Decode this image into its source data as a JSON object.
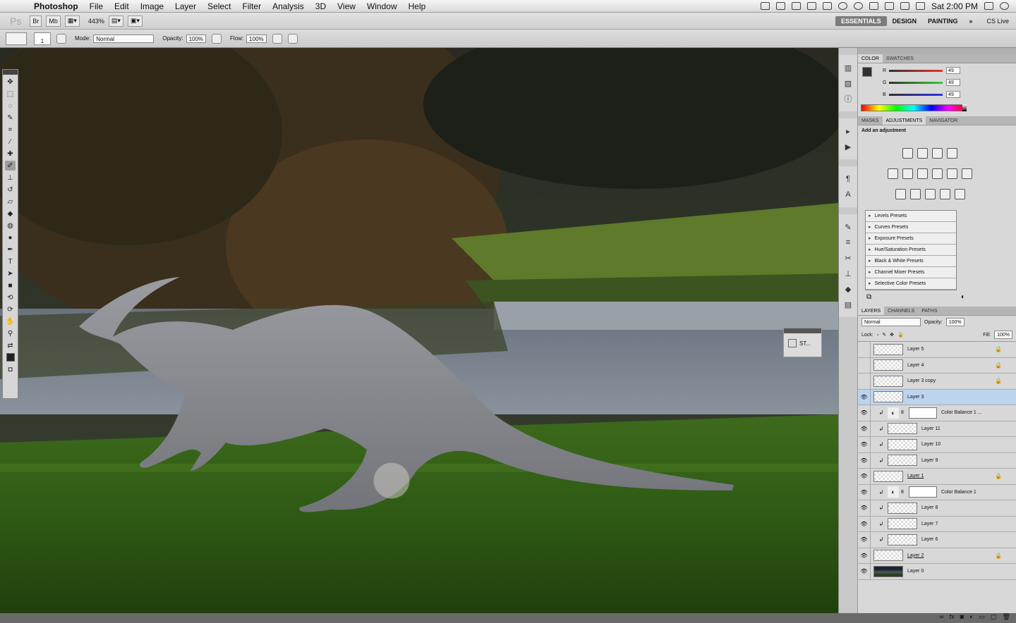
{
  "menubar": {
    "app": "Photoshop",
    "items": [
      "File",
      "Edit",
      "Image",
      "Layer",
      "Select",
      "Filter",
      "Analysis",
      "3D",
      "View",
      "Window",
      "Help"
    ],
    "clock": "Sat 2:00 PM"
  },
  "appbar": {
    "logo": "Ps",
    "zoom": "443%",
    "workspaces": [
      "ESSENTIALS",
      "DESIGN",
      "PAINTING"
    ],
    "more": "»",
    "cslive": "CS Live"
  },
  "options": {
    "brush_size": "1",
    "mode_label": "Mode:",
    "mode_value": "Normal",
    "opacity_label": "Opacity:",
    "opacity_value": "100%",
    "flow_label": "Flow:",
    "flow_value": "100%"
  },
  "mini_panel": {
    "label": "ST..."
  },
  "color_panel": {
    "tabs": [
      "COLOR",
      "SWATCHES"
    ],
    "r_label": "R",
    "g_label": "G",
    "b_label": "B",
    "r": "49",
    "g": "49",
    "b": "49",
    "foreground": "#313131"
  },
  "adjust_panel": {
    "tabs": [
      "MASKS",
      "ADJUSTMENTS",
      "NAVIGATOR"
    ],
    "title": "Add an adjustment",
    "presets": [
      "Levels Presets",
      "Curves Presets",
      "Exposure Presets",
      "Hue/Saturation Presets",
      "Black & White Presets",
      "Channel Mixer Presets",
      "Selective Color Presets"
    ]
  },
  "layers_panel": {
    "tabs": [
      "LAYERS",
      "CHANNELS",
      "PATHS"
    ],
    "blend": "Normal",
    "opacity_label": "Opacity:",
    "opacity": "100%",
    "lock_label": "Lock:",
    "fill_label": "Fill:",
    "fill": "100%",
    "layers": [
      {
        "name": "Layer 5",
        "visible": false,
        "locked": true,
        "type": "normal"
      },
      {
        "name": "Layer 4",
        "visible": false,
        "locked": true,
        "type": "normal"
      },
      {
        "name": "Layer 3 copy",
        "visible": false,
        "locked": true,
        "type": "normal"
      },
      {
        "name": "Layer 3",
        "visible": true,
        "locked": false,
        "type": "normal",
        "selected": true
      },
      {
        "name": "Color Balance 1 ...",
        "visible": true,
        "locked": false,
        "type": "adjust",
        "clipped": true
      },
      {
        "name": "Layer 11",
        "visible": true,
        "locked": false,
        "type": "normal",
        "clipped": true
      },
      {
        "name": "Layer 10",
        "visible": true,
        "locked": false,
        "type": "normal",
        "clipped": true
      },
      {
        "name": "Layer 9",
        "visible": true,
        "locked": false,
        "type": "normal",
        "clipped": true
      },
      {
        "name": "Layer 1",
        "visible": true,
        "locked": true,
        "type": "normal",
        "underline": true
      },
      {
        "name": "Color Balance 1",
        "visible": true,
        "locked": false,
        "type": "adjust",
        "clipped": true
      },
      {
        "name": "Layer 8",
        "visible": true,
        "locked": false,
        "type": "normal",
        "clipped": true
      },
      {
        "name": "Layer 7",
        "visible": true,
        "locked": false,
        "type": "normal",
        "clipped": true
      },
      {
        "name": "Layer 6",
        "visible": true,
        "locked": false,
        "type": "normal",
        "clipped": true
      },
      {
        "name": "Layer 2",
        "visible": true,
        "locked": true,
        "type": "normal",
        "underline": true
      },
      {
        "name": "Layer 0",
        "visible": true,
        "locked": false,
        "type": "photo"
      }
    ]
  }
}
